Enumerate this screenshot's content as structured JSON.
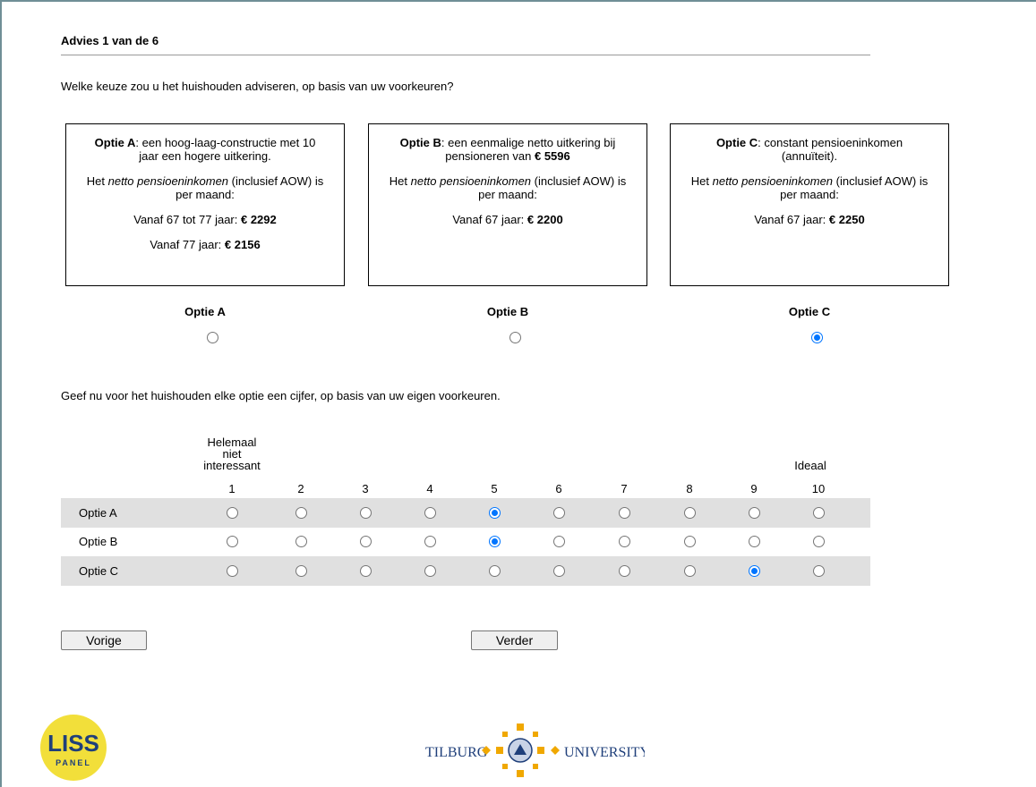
{
  "page": {
    "progress_title": "Advies 1 van de 6",
    "question": "Welke keuze zou u het huishouden adviseren, op basis van uw voorkeuren?"
  },
  "options": [
    {
      "name": "Optie A",
      "desc": ": een hoog-laag-constructie met 10 jaar een hogere uitkering.",
      "net_pre": "Het ",
      "net_em": "netto pensioeninkomen",
      "net_post": " (inclusief AOW) is per maand:",
      "lines": [
        {
          "label": "Vanaf 67 tot 77 jaar: ",
          "value": "€ 2292"
        },
        {
          "label": "Vanaf 77 jaar: ",
          "value": "€ 2156"
        }
      ],
      "radio_label": "Optie A",
      "selected": false
    },
    {
      "name": "Optie B",
      "desc_pre": ": een eenmalige netto uitkering bij pensioneren van ",
      "desc_value": "€ 5596",
      "net_pre": "Het ",
      "net_em": "netto pensioeninkomen",
      "net_post": " (inclusief AOW) is per maand:",
      "lines": [
        {
          "label": "Vanaf 67 jaar: ",
          "value": "€ 2200"
        }
      ],
      "radio_label": "Optie B",
      "selected": false
    },
    {
      "name": "Optie C",
      "desc": ": constant pensioeninkomen (annuïteit).",
      "net_pre": "Het ",
      "net_em": "netto pensioeninkomen",
      "net_post": " (inclusief AOW) is per maand:",
      "lines": [
        {
          "label": "Vanaf 67 jaar: ",
          "value": "€ 2250"
        }
      ],
      "radio_label": "Optie C",
      "selected": true
    }
  ],
  "rating": {
    "instruction": "Geef nu voor het huishouden elke optie een cijfer, op basis van uw eigen voorkeuren.",
    "low_anchor": [
      "Helemaal",
      "niet",
      "interessant"
    ],
    "high_anchor": "Ideaal",
    "scale": [
      "1",
      "2",
      "3",
      "4",
      "5",
      "6",
      "7",
      "8",
      "9",
      "10"
    ],
    "rows": [
      {
        "label": "Optie A",
        "value": 5
      },
      {
        "label": "Optie B",
        "value": 5
      },
      {
        "label": "Optie C",
        "value": 9
      }
    ]
  },
  "nav": {
    "prev_label": "Vorige",
    "next_label": "Verder"
  },
  "logos": {
    "liss_text": "LISS",
    "liss_sub": "PANEL",
    "tilburg_left": "TILBURG",
    "tilburg_right": "UNIVERSITY"
  },
  "colors": {
    "accent": "#0075ff",
    "row_shade": "#e0e0e0",
    "liss_yellow": "#f2df3a",
    "tilburg_blue": "#1f3f7a",
    "tilburg_gold": "#f0a800"
  }
}
